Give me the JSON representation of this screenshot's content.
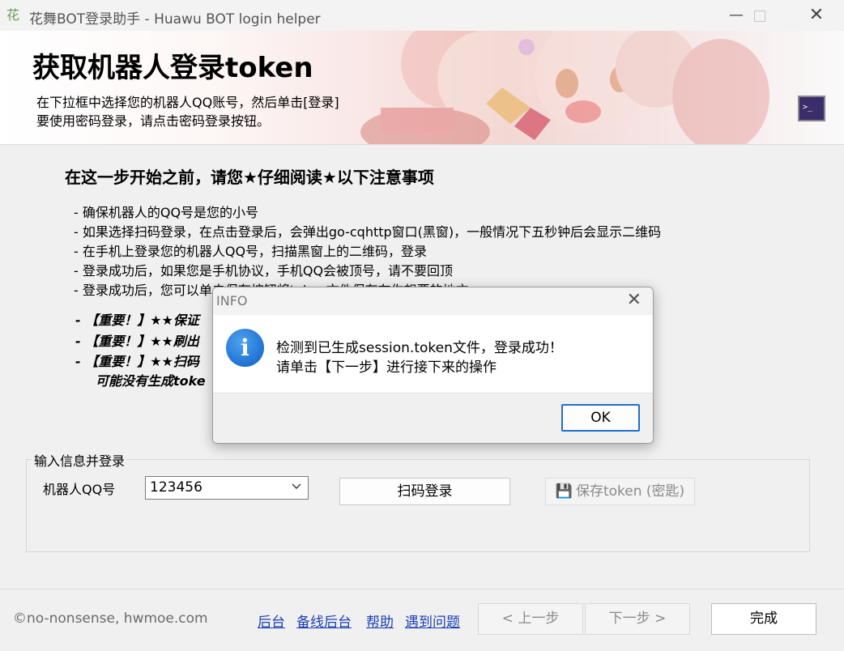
{
  "window": {
    "title": "花舞BOT登录助手 - Huawu BOT login helper",
    "icon": "花",
    "minimize": "—",
    "close": "✕"
  },
  "banner": {
    "title": "获取机器人登录token",
    "subtitle_line1": "在下拉框中选择您的机器人QQ账号，然后单击[登录]",
    "subtitle_line2": "要使用密码登录，请点击密码登录按钮。",
    "terminal_icon": ">_"
  },
  "notice": {
    "heading": "在这一步开始之前，请您★仔细阅读★以下注意事项",
    "lines": [
      "- 确保机器人的QQ号是您的小号",
      "- 如果选择扫码登录，在点击登录后，会弹出go-cqhttp窗口(黑窗)，一般情况下五秒钟后会显示二维码",
      "- 在手机上登录您的机器人QQ号，扫描黑窗上的二维码，登录",
      "- 登录成功后，如果您是手机协议，手机QQ会被顶号，请不要回顶",
      "- 登录成功后，您可以单击保存按钮将token文件保存在你想要的地方"
    ],
    "important": [
      "- 【重要！】★★保证",
      "- 【重要！】★★刷出",
      "- 【重要！】★★扫码",
      "可能没有生成toke"
    ]
  },
  "login_group": {
    "label": "输入信息并登录",
    "qq_label": "机器人QQ号",
    "qq_value": "123456",
    "scan_button": "扫码登录",
    "save_button": "保存token (密匙)"
  },
  "footer": {
    "copyright": "©no-nonsense, hwmoe.com",
    "links": [
      "后台",
      "备线后台",
      "帮助",
      "遇到问题"
    ],
    "prev": "< 上一步",
    "next": "下一步 >",
    "finish": "完成"
  },
  "dialog": {
    "title": "INFO",
    "close": "✕",
    "icon": "i",
    "message_line1": "检测到已生成session.token文件，登录成功！",
    "message_line2": "请单击【下一步】进行接下来的操作",
    "ok": "OK"
  },
  "colors": {
    "link": "#1a3fb5",
    "info_icon": "#1f72d1",
    "dialog_default_border": "#1e6fd0"
  }
}
